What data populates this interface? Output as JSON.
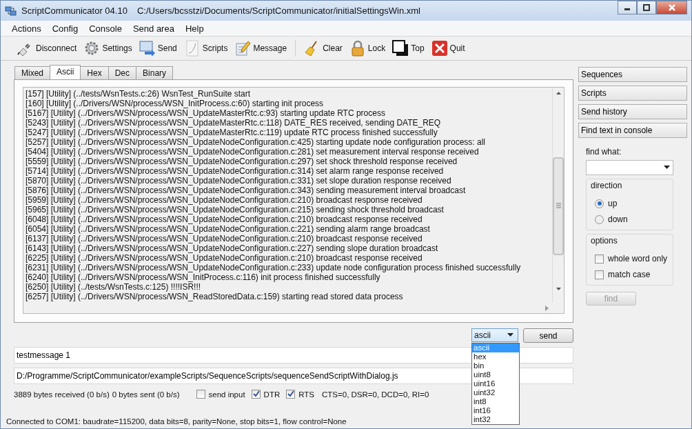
{
  "window": {
    "title": "ScriptCommunicator 04.10",
    "path": "C:/Users/bcsstzi/Documents/ScriptCommunicator/initialSettingsWin.xml"
  },
  "menu": [
    "Actions",
    "Config",
    "Console",
    "Send area",
    "Help"
  ],
  "toolbar": [
    {
      "label": "Disconnect",
      "kind": "plug"
    },
    {
      "label": "Settings",
      "kind": "gear"
    },
    {
      "label": "Send",
      "kind": "send"
    },
    {
      "label": "Scripts",
      "kind": "scripts"
    },
    {
      "label": "Message",
      "kind": "message"
    },
    {
      "label": "Clear",
      "kind": "broom",
      "separator_before": true
    },
    {
      "label": "Lock",
      "kind": "lock"
    },
    {
      "label": "Top",
      "kind": "top"
    },
    {
      "label": "Quit",
      "kind": "quit"
    }
  ],
  "tabs": [
    {
      "label": "Mixed",
      "selected": false
    },
    {
      "label": "Ascii",
      "selected": true
    },
    {
      "label": "Hex",
      "selected": false
    },
    {
      "label": "Dec",
      "selected": false
    },
    {
      "label": "Binary",
      "selected": false
    }
  ],
  "console": {
    "lines": [
      "[157] [Utility] (../tests/WsnTests.c:26) WsnTest_RunSuite start",
      "[160] [Utility] (../Drivers/WSN/process/WSN_InitProcess.c:60) starting init process",
      "[5167] [Utility] (../Drivers/WSN/process/WSN_UpdateMasterRtc.c:93) starting update RTC process",
      "[5243] [Utility] (../Drivers/WSN/process/WSN_UpdateMasterRtc.c:118) DATE_RES received, sending DATE_REQ",
      "[5247] [Utility] (../Drivers/WSN/process/WSN_UpdateMasterRtc.c:119) update RTC process finished successfully",
      "[5257] [Utility] (../Drivers/WSN/process/WSN_UpdateNodeConfiguration.c:425) starting update node configuration process: all",
      "[5404] [Utility] (../Drivers/WSN/process/WSN_UpdateNodeConfiguration.c:281) set measurement interval response received",
      "[5559] [Utility] (../Drivers/WSN/process/WSN_UpdateNodeConfiguration.c:297) set shock threshold response received",
      "[5714] [Utility] (../Drivers/WSN/process/WSN_UpdateNodeConfiguration.c:314) set alarm range response received",
      "[5870] [Utility] (../Drivers/WSN/process/WSN_UpdateNodeConfiguration.c:331) set slope duration response received",
      "[5876] [Utility] (../Drivers/WSN/process/WSN_UpdateNodeConfiguration.c:343) sending measurement interval broadcast",
      "[5959] [Utility] (../Drivers/WSN/process/WSN_UpdateNodeConfiguration.c:210) broadcast response received",
      "[5965] [Utility] (../Drivers/WSN/process/WSN_UpdateNodeConfiguration.c:215) sending shock threshold broadcast",
      "[6048] [Utility] (../Drivers/WSN/process/WSN_UpdateNodeConfiguration.c:210) broadcast response received",
      "[6054] [Utility] (../Drivers/WSN/process/WSN_UpdateNodeConfiguration.c:221) sending alarm range broadcast",
      "[6137] [Utility] (../Drivers/WSN/process/WSN_UpdateNodeConfiguration.c:210) broadcast response received",
      "[6143] [Utility] (../Drivers/WSN/process/WSN_UpdateNodeConfiguration.c:227) sending slope duration broadcast",
      "[6225] [Utility] (../Drivers/WSN/process/WSN_UpdateNodeConfiguration.c:210) broadcast response received",
      "[6231] [Utility] (../Drivers/WSN/process/WSN_UpdateNodeConfiguration.c:233) update node configuration process finished successfully",
      "[6240] [Utility] (../Drivers/WSN/process/WSN_InitProcess.c:116) init process finished successfully",
      "[6250] [Utility] (../tests/WsnTests.c:125) !!!!ISR!!!",
      "[6257] [Utility] (../Drivers/WSN/process/WSN_ReadStoredData.c:159) starting read stored data process"
    ]
  },
  "send_format": {
    "value": "ascii",
    "expanded": true,
    "options": [
      {
        "label": "ascii",
        "selected": true
      },
      {
        "label": "hex",
        "selected": false
      },
      {
        "label": "bin",
        "selected": false
      },
      {
        "label": "uint8",
        "selected": false
      },
      {
        "label": "uint16",
        "selected": false
      },
      {
        "label": "uint32",
        "selected": false
      },
      {
        "label": "int8",
        "selected": false
      },
      {
        "label": "int16",
        "selected": false
      },
      {
        "label": "int32",
        "selected": false
      }
    ]
  },
  "send_button": "send",
  "send_input": {
    "value": "testmessage 1"
  },
  "script_path": {
    "value": "D:/Programme/ScriptCommunicator/exampleScripts/SequenceScripts/sequenceSendScriptWithDialog.js"
  },
  "counters": {
    "received": "3889 bytes received (0 b/s)",
    "sent": "0 bytes sent (0 b/s)"
  },
  "line_checks": [
    {
      "label": "send input",
      "checked": false
    },
    {
      "label": "DTR",
      "checked": true
    },
    {
      "label": "RTS",
      "checked": true
    }
  ],
  "line_status": "CTS=0, DSR=0, DCD=0, RI=0",
  "status_bar": "Connected to COM1: baudrate=115200, data bits=8, parity=None, stop bits=1, flow control=None",
  "side_buttons": [
    "Sequences",
    "Scripts",
    "Send history",
    "Find text in console"
  ],
  "find": {
    "label": "find what:",
    "direction_title": "direction",
    "directions": [
      {
        "label": "up",
        "selected": true
      },
      {
        "label": "down",
        "selected": false
      }
    ],
    "options_title": "options",
    "options": [
      {
        "label": "whole word only",
        "checked": false
      },
      {
        "label": "match case",
        "checked": false
      }
    ],
    "button": {
      "label": "find",
      "disabled": true
    }
  }
}
